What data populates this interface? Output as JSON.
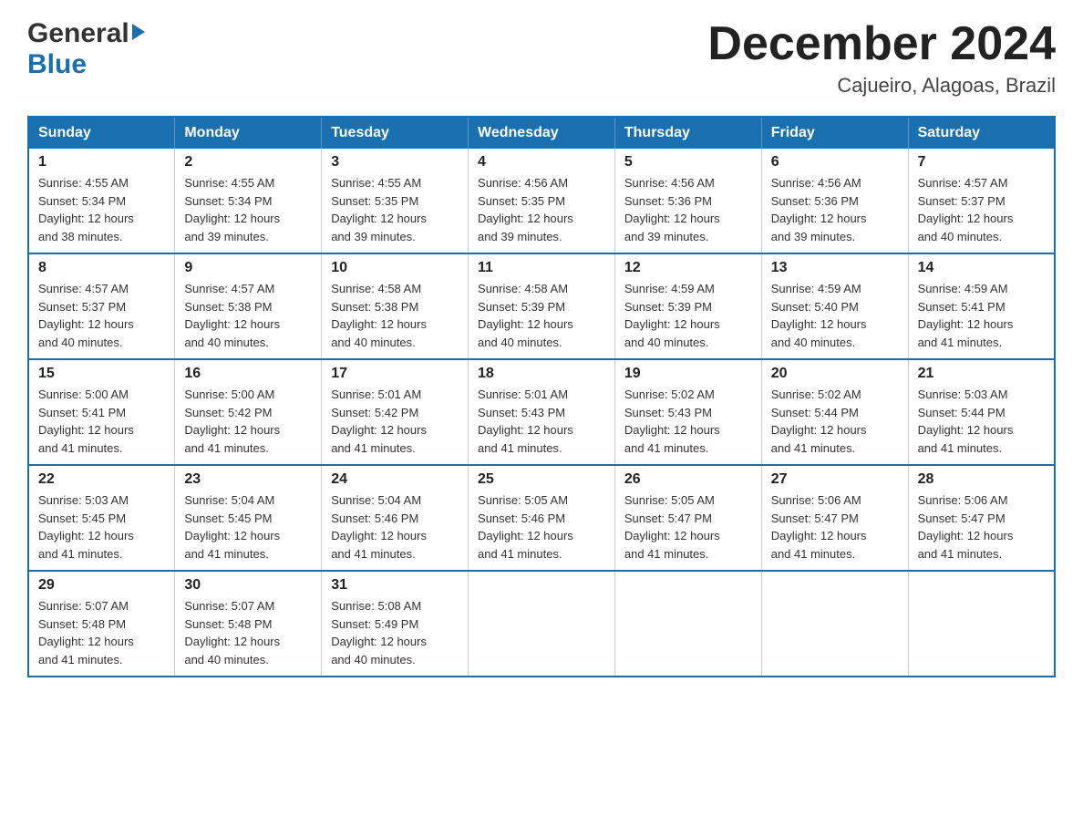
{
  "header": {
    "logo_general": "General",
    "logo_blue": "Blue",
    "month_title": "December 2024",
    "location": "Cajueiro, Alagoas, Brazil"
  },
  "weekdays": [
    "Sunday",
    "Monday",
    "Tuesday",
    "Wednesday",
    "Thursday",
    "Friday",
    "Saturday"
  ],
  "weeks": [
    [
      {
        "day": "1",
        "sunrise": "4:55 AM",
        "sunset": "5:34 PM",
        "daylight": "12 hours and 38 minutes."
      },
      {
        "day": "2",
        "sunrise": "4:55 AM",
        "sunset": "5:34 PM",
        "daylight": "12 hours and 39 minutes."
      },
      {
        "day": "3",
        "sunrise": "4:55 AM",
        "sunset": "5:35 PM",
        "daylight": "12 hours and 39 minutes."
      },
      {
        "day": "4",
        "sunrise": "4:56 AM",
        "sunset": "5:35 PM",
        "daylight": "12 hours and 39 minutes."
      },
      {
        "day": "5",
        "sunrise": "4:56 AM",
        "sunset": "5:36 PM",
        "daylight": "12 hours and 39 minutes."
      },
      {
        "day": "6",
        "sunrise": "4:56 AM",
        "sunset": "5:36 PM",
        "daylight": "12 hours and 39 minutes."
      },
      {
        "day": "7",
        "sunrise": "4:57 AM",
        "sunset": "5:37 PM",
        "daylight": "12 hours and 40 minutes."
      }
    ],
    [
      {
        "day": "8",
        "sunrise": "4:57 AM",
        "sunset": "5:37 PM",
        "daylight": "12 hours and 40 minutes."
      },
      {
        "day": "9",
        "sunrise": "4:57 AM",
        "sunset": "5:38 PM",
        "daylight": "12 hours and 40 minutes."
      },
      {
        "day": "10",
        "sunrise": "4:58 AM",
        "sunset": "5:38 PM",
        "daylight": "12 hours and 40 minutes."
      },
      {
        "day": "11",
        "sunrise": "4:58 AM",
        "sunset": "5:39 PM",
        "daylight": "12 hours and 40 minutes."
      },
      {
        "day": "12",
        "sunrise": "4:59 AM",
        "sunset": "5:39 PM",
        "daylight": "12 hours and 40 minutes."
      },
      {
        "day": "13",
        "sunrise": "4:59 AM",
        "sunset": "5:40 PM",
        "daylight": "12 hours and 40 minutes."
      },
      {
        "day": "14",
        "sunrise": "4:59 AM",
        "sunset": "5:41 PM",
        "daylight": "12 hours and 41 minutes."
      }
    ],
    [
      {
        "day": "15",
        "sunrise": "5:00 AM",
        "sunset": "5:41 PM",
        "daylight": "12 hours and 41 minutes."
      },
      {
        "day": "16",
        "sunrise": "5:00 AM",
        "sunset": "5:42 PM",
        "daylight": "12 hours and 41 minutes."
      },
      {
        "day": "17",
        "sunrise": "5:01 AM",
        "sunset": "5:42 PM",
        "daylight": "12 hours and 41 minutes."
      },
      {
        "day": "18",
        "sunrise": "5:01 AM",
        "sunset": "5:43 PM",
        "daylight": "12 hours and 41 minutes."
      },
      {
        "day": "19",
        "sunrise": "5:02 AM",
        "sunset": "5:43 PM",
        "daylight": "12 hours and 41 minutes."
      },
      {
        "day": "20",
        "sunrise": "5:02 AM",
        "sunset": "5:44 PM",
        "daylight": "12 hours and 41 minutes."
      },
      {
        "day": "21",
        "sunrise": "5:03 AM",
        "sunset": "5:44 PM",
        "daylight": "12 hours and 41 minutes."
      }
    ],
    [
      {
        "day": "22",
        "sunrise": "5:03 AM",
        "sunset": "5:45 PM",
        "daylight": "12 hours and 41 minutes."
      },
      {
        "day": "23",
        "sunrise": "5:04 AM",
        "sunset": "5:45 PM",
        "daylight": "12 hours and 41 minutes."
      },
      {
        "day": "24",
        "sunrise": "5:04 AM",
        "sunset": "5:46 PM",
        "daylight": "12 hours and 41 minutes."
      },
      {
        "day": "25",
        "sunrise": "5:05 AM",
        "sunset": "5:46 PM",
        "daylight": "12 hours and 41 minutes."
      },
      {
        "day": "26",
        "sunrise": "5:05 AM",
        "sunset": "5:47 PM",
        "daylight": "12 hours and 41 minutes."
      },
      {
        "day": "27",
        "sunrise": "5:06 AM",
        "sunset": "5:47 PM",
        "daylight": "12 hours and 41 minutes."
      },
      {
        "day": "28",
        "sunrise": "5:06 AM",
        "sunset": "5:47 PM",
        "daylight": "12 hours and 41 minutes."
      }
    ],
    [
      {
        "day": "29",
        "sunrise": "5:07 AM",
        "sunset": "5:48 PM",
        "daylight": "12 hours and 41 minutes."
      },
      {
        "day": "30",
        "sunrise": "5:07 AM",
        "sunset": "5:48 PM",
        "daylight": "12 hours and 40 minutes."
      },
      {
        "day": "31",
        "sunrise": "5:08 AM",
        "sunset": "5:49 PM",
        "daylight": "12 hours and 40 minutes."
      },
      null,
      null,
      null,
      null
    ]
  ],
  "labels": {
    "sunrise": "Sunrise:",
    "sunset": "Sunset:",
    "daylight": "Daylight:"
  }
}
